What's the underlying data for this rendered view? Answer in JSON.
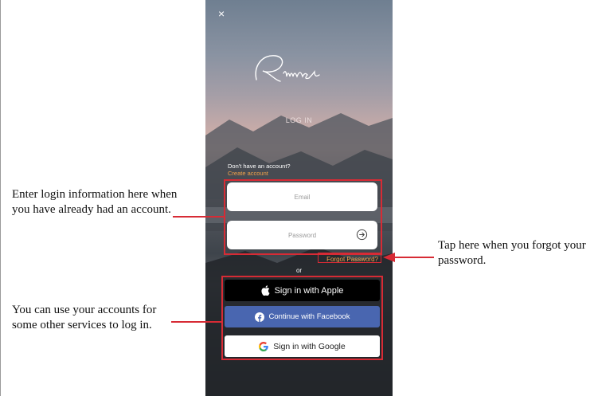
{
  "app": {
    "close_glyph": "×",
    "logo_text": "Riiiver",
    "heading": "LOG IN",
    "no_account_text": "Don't have an account?",
    "create_account_link": "Create account"
  },
  "form": {
    "email_placeholder": "Email",
    "password_placeholder": "Password",
    "forgot_password": "Forgot Password?",
    "or_label": "or"
  },
  "sso": {
    "apple_label": "Sign in with Apple",
    "facebook_label": "Continue with Facebook",
    "google_label": "Sign in with Google"
  },
  "annotations": {
    "login_note": "Enter login information here when you have already had an account.",
    "sso_note": "You can use your accounts for some other services to log in.",
    "forgot_note": "Tap here when you forgot your password."
  },
  "colors": {
    "highlight": "#d72b35",
    "link_orange": "#f0a24a",
    "facebook_blue": "#4966b0",
    "apple_black": "#000000"
  },
  "icons": [
    "close-icon",
    "arrow-right-circle-icon",
    "apple-icon",
    "facebook-icon",
    "google-icon"
  ]
}
